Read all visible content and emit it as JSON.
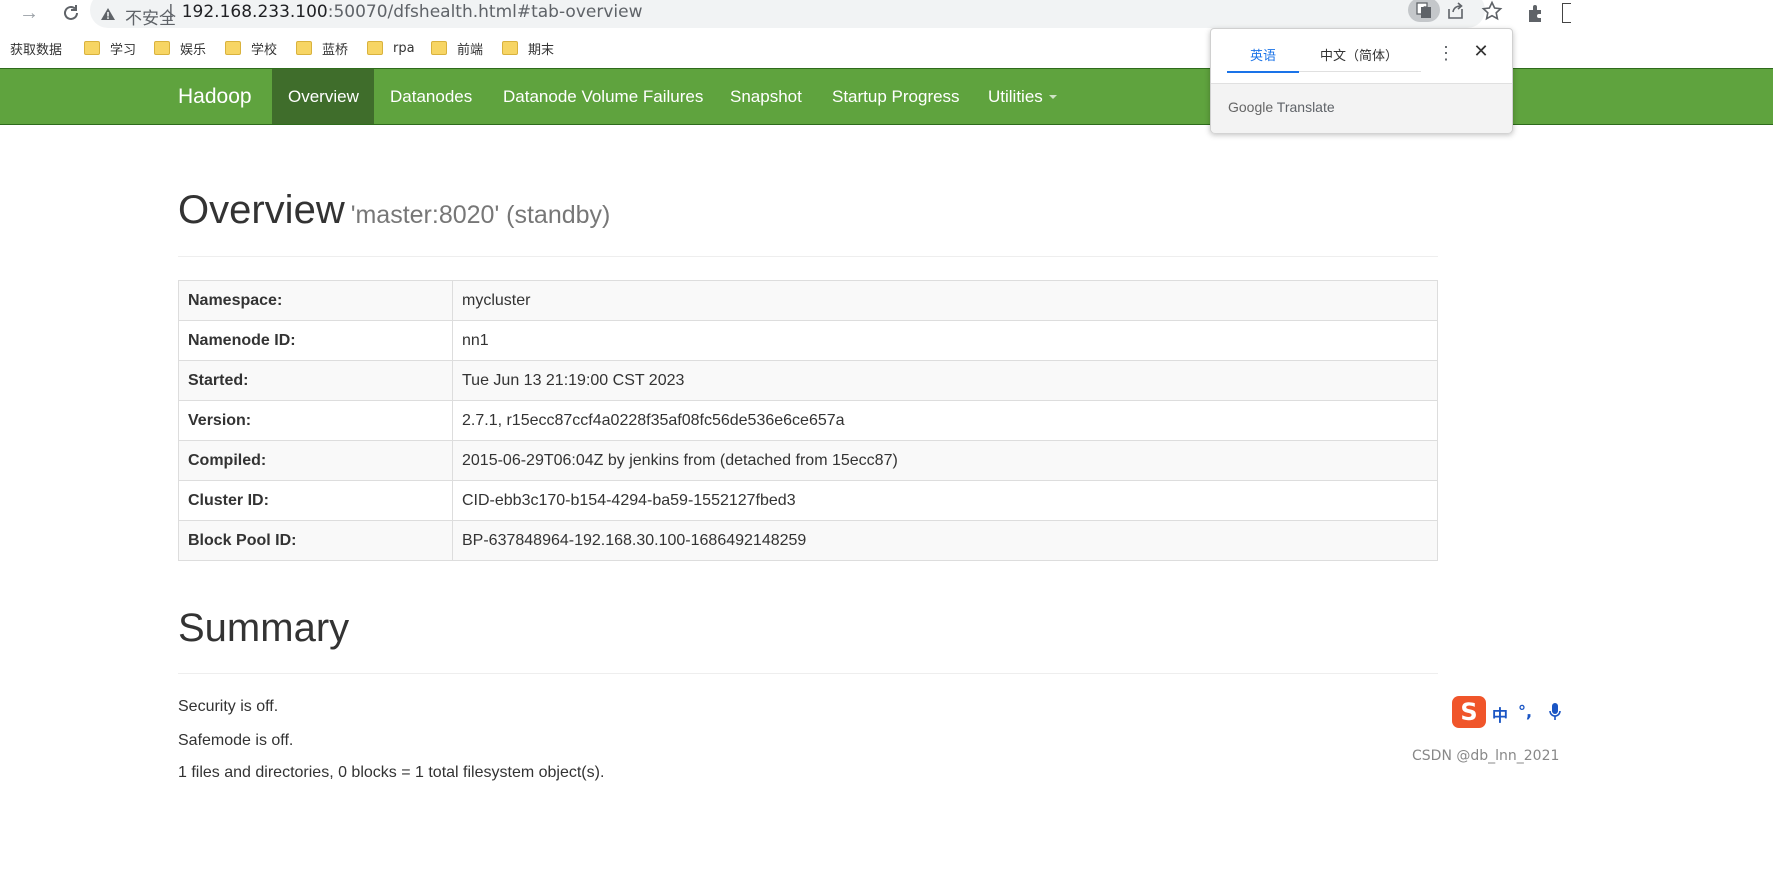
{
  "browser": {
    "insecure_label": "不安全",
    "url_host": "192.168.233.100",
    "url_rest": ":50070/dfshealth.html#tab-overview",
    "separator": "|"
  },
  "bookmarks": [
    {
      "label": "获取数据",
      "folder": false
    },
    {
      "label": "学习",
      "folder": true
    },
    {
      "label": "娱乐",
      "folder": true
    },
    {
      "label": "学校",
      "folder": true
    },
    {
      "label": "蓝桥",
      "folder": true
    },
    {
      "label": "rpa",
      "folder": true
    },
    {
      "label": "前端",
      "folder": true
    },
    {
      "label": "期末",
      "folder": true
    }
  ],
  "navbar": {
    "brand": "Hadoop",
    "items": [
      {
        "label": "Overview",
        "active": true
      },
      {
        "label": "Datanodes",
        "active": false
      },
      {
        "label": "Datanode Volume Failures",
        "active": false
      },
      {
        "label": "Snapshot",
        "active": false
      },
      {
        "label": "Startup Progress",
        "active": false
      },
      {
        "label": "Utilities",
        "active": false
      }
    ]
  },
  "translate_popup": {
    "tab_source": "英语",
    "tab_target": "中文（简体）",
    "footer_google": "Google",
    "footer_translate": "Translate"
  },
  "overview": {
    "title": "Overview",
    "subtitle": "'master:8020' (standby)",
    "rows": [
      {
        "key": "Namespace:",
        "value": "mycluster"
      },
      {
        "key": "Namenode ID:",
        "value": "nn1"
      },
      {
        "key": "Started:",
        "value": "Tue Jun 13 21:19:00 CST 2023"
      },
      {
        "key": "Version:",
        "value": "2.7.1, r15ecc87ccf4a0228f35af08fc56de536e6ce657a"
      },
      {
        "key": "Compiled:",
        "value": "2015-06-29T06:04Z by jenkins from (detached from 15ecc87)"
      },
      {
        "key": "Cluster ID:",
        "value": "CID-ebb3c170-b154-4294-ba59-1552127fbed3"
      },
      {
        "key": "Block Pool ID:",
        "value": "BP-637848964-192.168.30.100-1686492148259"
      }
    ]
  },
  "summary": {
    "title": "Summary",
    "security": "Security is off.",
    "safemode": "Safemode is off.",
    "files": "1 files and directories, 0 blocks = 1 total filesystem object(s)."
  },
  "ime": {
    "mode": "中",
    "punct": "°,"
  },
  "watermark": "CSDN @db_lnn_2021",
  "colors": {
    "navbar": "#5fa33e",
    "navbar_active": "#3f6d2b",
    "translate_accent": "#1a73e8"
  }
}
